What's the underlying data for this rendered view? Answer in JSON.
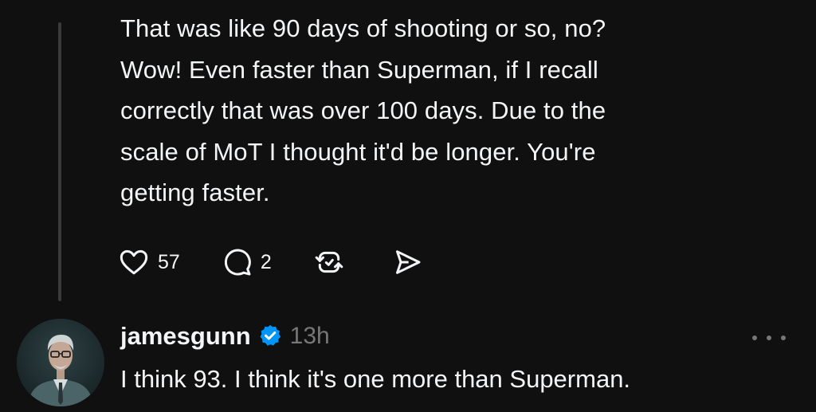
{
  "post": {
    "text": "That was like 90 days of shooting or so, no?\nWow! Even faster than Superman, if I recall\ncorrectly that was over 100 days. Due to the\nscale of MoT I thought it'd be longer. You're\ngetting faster.",
    "like_count": "57",
    "reply_count": "2"
  },
  "reply": {
    "username": "jamesgunn",
    "verified": true,
    "timestamp": "13h",
    "text": "I think 93. I think it's one more than Superman."
  },
  "icons": {
    "like": "heart-icon",
    "reply": "comment-icon",
    "repost": "repost-icon",
    "share": "send-icon",
    "verified": "verified-badge-icon",
    "more": "more-options-icon"
  },
  "colors": {
    "background": "#101010",
    "text": "#f3f5f7",
    "muted": "#777777",
    "verified": "#0095f6",
    "thread_line": "#3a3a3a"
  }
}
